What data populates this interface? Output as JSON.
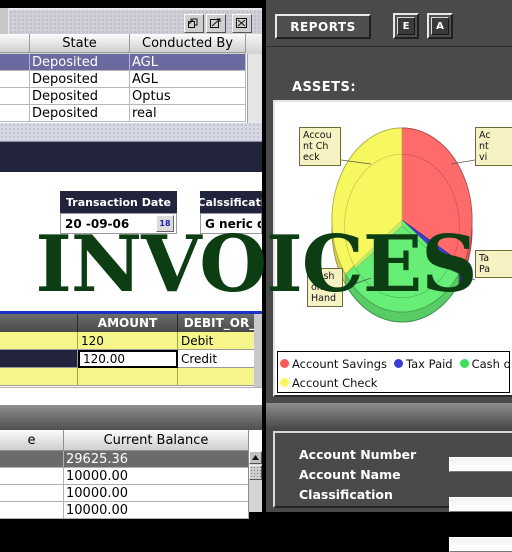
{
  "top_window": {
    "title_buttons": [
      "restore-button",
      "maximize-button",
      "close-button"
    ],
    "columns": [
      "",
      "State",
      "Conducted By"
    ],
    "rows": [
      {
        "blank": "",
        "state": "Deposited",
        "conducted_by": "AGL",
        "selected": true
      },
      {
        "blank": "",
        "state": "Deposited",
        "conducted_by": "AGL",
        "selected": false
      },
      {
        "blank": "",
        "state": "Deposited",
        "conducted_by": "Optus",
        "selected": false
      },
      {
        "blank": "",
        "state": "Deposited",
        "conducted_by": "real",
        "selected": false
      }
    ]
  },
  "mid_window": {
    "fields": [
      {
        "label": "Transaction Date",
        "value": "20  -09-06",
        "spinner": "18"
      },
      {
        "label": "Calssificati",
        "value": "G  neric o"
      }
    ],
    "amount_table": {
      "columns": [
        "",
        "AMOUNT",
        "DEBIT_OR_"
      ],
      "rows": [
        {
          "c0": "",
          "amount": "120",
          "debit_or": "Debit",
          "selected": false
        },
        {
          "c0": "",
          "amount": "120.00",
          "debit_or": "Credit",
          "selected": true
        },
        {
          "c0": "",
          "amount": "",
          "debit_or": "",
          "selected": false
        }
      ]
    }
  },
  "balance_window": {
    "columns": [
      "e",
      "Current Balance"
    ],
    "rows": [
      {
        "name": "",
        "balance": "29625.36",
        "selected": true
      },
      {
        "name": "",
        "balance": "10000.00",
        "selected": false
      },
      {
        "name": "",
        "balance": "10000.00",
        "selected": false
      },
      {
        "name": "",
        "balance": "10000.00",
        "selected": false
      }
    ],
    "scroll_up_icon": "triangle-up-icon"
  },
  "right_panel": {
    "tab_label": "REPORTS",
    "button_e": "E",
    "button_a": "A",
    "section_title": "ASSETS:",
    "form": {
      "rows": [
        {
          "label": "Account Number",
          "value": ""
        },
        {
          "label": "Account Name",
          "value": ""
        },
        {
          "label": "Classification",
          "value": ""
        }
      ]
    }
  },
  "watermark": {
    "text": "INVOICES",
    "color": "#0d3d12"
  },
  "chart_data": {
    "type": "pie",
    "title": "ASSETS:",
    "labels": [
      "Account Savings",
      "Tax Paid",
      "Cash on Hand",
      "Account Check"
    ],
    "values": [
      33,
      2,
      30,
      35
    ],
    "colors": [
      "#ff6b6b",
      "#3a3ad8",
      "#66ee77",
      "#f7f760"
    ],
    "legend": [
      {
        "label": "Account Savings",
        "color": "#ff5a5a"
      },
      {
        "label": "Tax Paid",
        "color": "#3a3ad8"
      },
      {
        "label": "Cash o",
        "color": "#3ce05c"
      },
      {
        "label": "Account Check",
        "color": "#f7f760"
      }
    ],
    "legend_position": "bottom",
    "callouts": [
      {
        "text": "Accou nt Ch eck",
        "lines": [
          "Accou",
          "nt Ch",
          "eck"
        ]
      },
      {
        "text": "Ac nt vi",
        "lines": [
          "Ac",
          "nt",
          "vi"
        ]
      },
      {
        "text": "Ta Pa",
        "lines": [
          "Ta",
          "Pa"
        ]
      },
      {
        "text": "Cash on Hand",
        "lines": [
          "Cash",
          "on",
          "Hand"
        ]
      }
    ],
    "grid": false
  }
}
